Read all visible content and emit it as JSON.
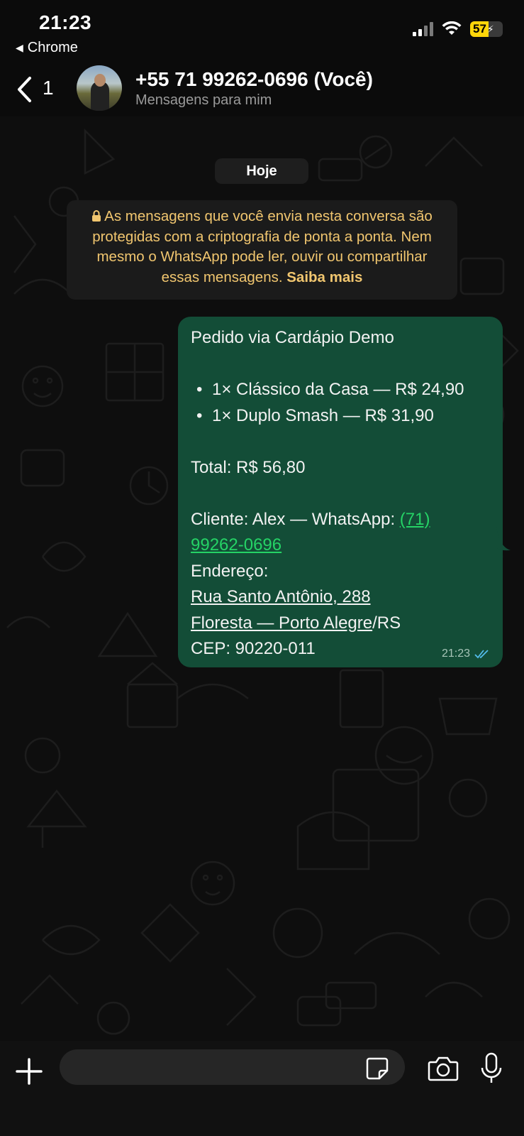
{
  "status_bar": {
    "time": "21:23",
    "back_app": "Chrome",
    "back_glyph": "◀",
    "battery_level": 57,
    "battery_text": "57",
    "colors": {
      "battery": "#ffd60a"
    }
  },
  "header": {
    "back_count": "1",
    "contact_name": "+55 71 99262-0696 (Você)",
    "subtitle": "Mensagens para mim"
  },
  "chat": {
    "date_chip": "Hoje",
    "encryption_notice": {
      "text": "As mensagens que você envia nesta conversa são protegidas com a criptografia de ponta a ponta. Nem mesmo o WhatsApp pode ler, ouvir ou compartilhar essas mensagens.",
      "link": "Saiba mais",
      "color": "#f1c66f"
    },
    "message": {
      "title": "Pedido via Cardápio Demo",
      "items": [
        "1× Clássico da Casa — R$ 24,90",
        "1× Duplo Smash — R$ 31,90"
      ],
      "total": "Total: R$ 56,80",
      "client_prefix": "Cliente: Alex — WhatsApp: ",
      "phone_line1": "(71)",
      "phone_line2": "99262-0696",
      "address_label": "Endereço:",
      "street": "Rua Santo Antônio, 288",
      "neighborhood_city": "Floresta — Porto Alegre",
      "state": "/RS",
      "cep": "CEP: 90220-011",
      "time": "21:23",
      "status": "read",
      "bubble_color": "#134d37",
      "link_color": "#25d366"
    }
  },
  "input_bar": {
    "placeholder": "",
    "icons": [
      "plus-icon",
      "sticker-icon",
      "camera-icon",
      "microphone-icon"
    ]
  }
}
